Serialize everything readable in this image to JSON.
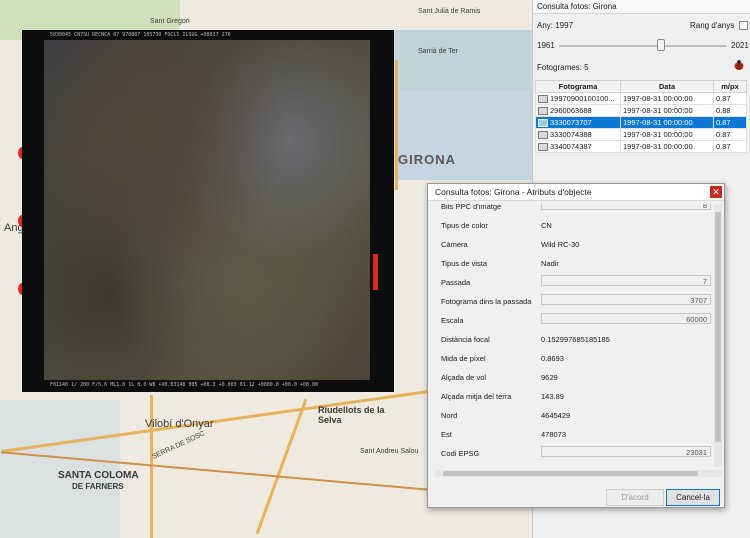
{
  "map": {
    "labels": {
      "girona": "GIRONA",
      "vilobi": "Vilobí d'Onyar",
      "riudellots": "Riudellots de la Selva",
      "santa_coloma": "SANTA COLOMA",
      "de_farners": "DE FARNERS",
      "salou": "Sant Andreu Salou",
      "ang": "Ang",
      "sarria": "Sarrià de Ter",
      "st_gregori": "Sant Gregori",
      "serra": "SERRA DE SOSC",
      "st_julia": "Sant Julià de Ramis"
    }
  },
  "photo": {
    "strip_top": "5030045 CN7SU  RECNCA   07  970807  105730  FOCL5  ILSUG  +00037  270",
    "strip_bottom": "F01140  1/ 200  F/5.6   ML1.0  1L 8.0  W8 +V0.03148  005  +08.3  +0.003  01.12  +0000.0  +00.0  +00.00"
  },
  "panel": {
    "title": "Consulta fotos: Girona",
    "year_label": "Any: 1997",
    "range_label": "Rang d'anys",
    "range_checked": false,
    "slider_min": "1961",
    "slider_max": "2021",
    "slider_value": 1997,
    "photo_count": "Fotogrames: 5",
    "bug_icon": "ladybug-icon",
    "columns": [
      "Fotograma",
      "Data",
      "m/px"
    ],
    "rows": [
      {
        "id": "19970900100100...",
        "date": "1997-08-31 00:00:00",
        "mpx": "0.87"
      },
      {
        "id": "2960063688",
        "date": "1997-08-31 00:00:00",
        "mpx": "0.88"
      },
      {
        "id": "3330073707",
        "date": "1997-08-31 00:00:00",
        "mpx": "0.87"
      },
      {
        "id": "3330074388",
        "date": "1997-08-31 00:00:00",
        "mpx": "0.87"
      },
      {
        "id": "3340074387",
        "date": "1997-08-31 00:00:00",
        "mpx": "0.87"
      }
    ],
    "selected_row": 2
  },
  "dialog": {
    "title": "Consulta fotos: Girona - Atributs d'objecte",
    "close_icon": "close-icon",
    "attributes": [
      {
        "label": "Bits PPC d'imatge",
        "value": "8",
        "boxed": true
      },
      {
        "label": "Tipus de color",
        "value": "CN",
        "boxed": false
      },
      {
        "label": "Càmera",
        "value": "Wild RC-30",
        "boxed": false
      },
      {
        "label": "Tipus de vista",
        "value": "Nadir",
        "boxed": false
      },
      {
        "label": "Passada",
        "value": "7",
        "boxed": true
      },
      {
        "label": "Fotograma dins la passada",
        "value": "3707",
        "boxed": true
      },
      {
        "label": "Escala",
        "value": "60000",
        "boxed": true
      },
      {
        "label": "Distància focal",
        "value": "0.152997685185185",
        "boxed": false
      },
      {
        "label": "Mida de píxel",
        "value": "0.8693",
        "boxed": false
      },
      {
        "label": "Alçada de vol",
        "value": "9629",
        "boxed": false
      },
      {
        "label": "Alçada mitja del terra",
        "value": "143.89",
        "boxed": false
      },
      {
        "label": "Nord",
        "value": "4645429",
        "boxed": false
      },
      {
        "label": "Est",
        "value": "478073",
        "boxed": false
      },
      {
        "label": "Codi EPSG",
        "value": "23031",
        "boxed": true
      }
    ],
    "ok_label": "D'acord",
    "cancel_label": "Cancel·la"
  }
}
